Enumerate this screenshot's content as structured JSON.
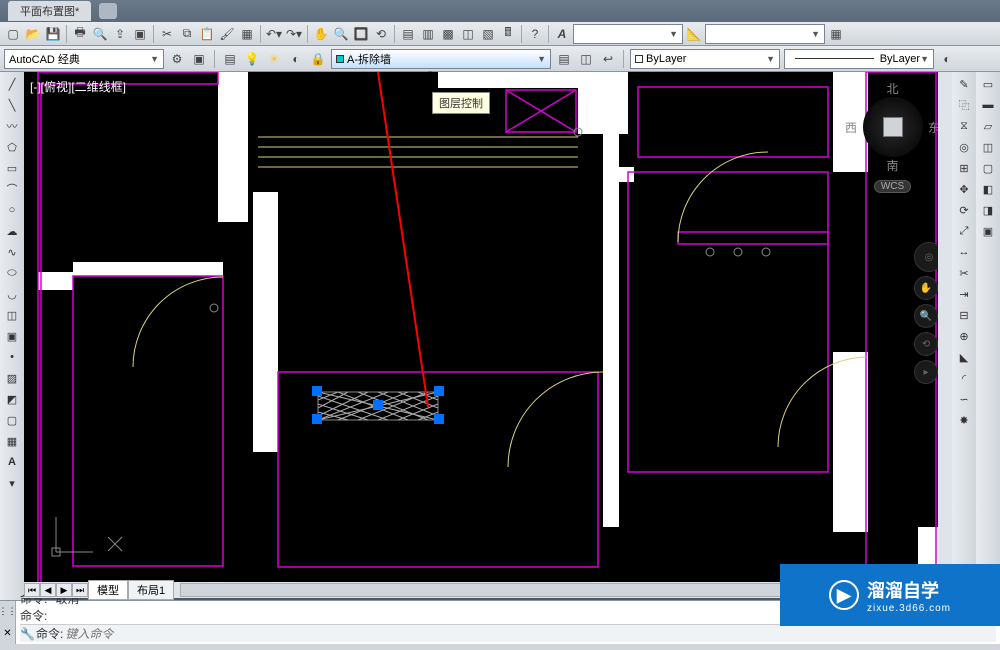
{
  "title_tab": "平面布置图*",
  "workspace": {
    "name": "AutoCAD 经典"
  },
  "layer": {
    "current": "A-拆除墙",
    "color": "cyan"
  },
  "color_control": {
    "value": "ByLayer"
  },
  "linetype_control": {
    "value": "ByLayer"
  },
  "annotation_style": {
    "value": "A"
  },
  "view_label": "[-][俯视][二维线框]",
  "tooltip": "图层控制",
  "compass": {
    "n": "北",
    "s": "南",
    "e": "东",
    "w": "西",
    "wcs": "WCS"
  },
  "paper_tabs": {
    "model": "模型",
    "layout1": "布局1"
  },
  "command": {
    "line1": "命令: *取消*",
    "line2": "命令:",
    "prompt_placeholder": "键入命令",
    "prompt_prefix": "命令:"
  },
  "watermark": {
    "brand": "溜溜自学",
    "url": "zixue.3d66.com"
  },
  "a_label": "A"
}
